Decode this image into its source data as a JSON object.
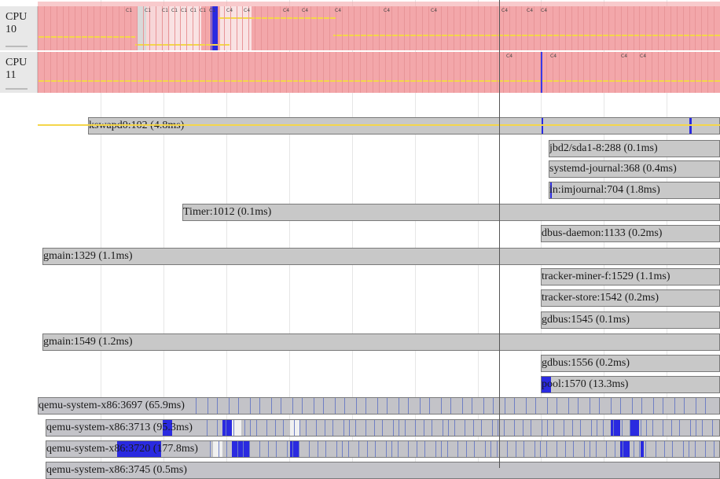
{
  "cpus": [
    {
      "label": "CPU 10",
      "marks": [
        "C1",
        "C1",
        "C1",
        "C1",
        "C1",
        "C1",
        "C1",
        "C1",
        "C4",
        "C4",
        "C4",
        "C4",
        "C4",
        "C4",
        "C4",
        "C4",
        "C4",
        "C4"
      ]
    },
    {
      "label": "CPU 11",
      "marks": [
        "C4",
        "C4",
        "C4",
        "C4"
      ]
    }
  ],
  "threads": [
    {
      "name": "kswapd0",
      "tid": 102,
      "duration": "4.8ms",
      "label": "kswapd0:102 (4.8ms)"
    },
    {
      "name": "jbd2/sda1-8",
      "tid": 288,
      "duration": "0.1ms",
      "label": "jbd2/sda1-8:288 (0.1ms)"
    },
    {
      "name": "systemd-journal",
      "tid": 368,
      "duration": "0.4ms",
      "label": "systemd-journal:368 (0.4ms)"
    },
    {
      "name": "in:imjournal",
      "tid": 704,
      "duration": "1.8ms",
      "label": "in:imjournal:704 (1.8ms)"
    },
    {
      "name": "Timer",
      "tid": 1012,
      "duration": "0.1ms",
      "label": "Timer:1012 (0.1ms)"
    },
    {
      "name": "dbus-daemon",
      "tid": 1133,
      "duration": "0.2ms",
      "label": "dbus-daemon:1133 (0.2ms)"
    },
    {
      "name": "gmain",
      "tid": 1329,
      "duration": "1.1ms",
      "label": "gmain:1329 (1.1ms)"
    },
    {
      "name": "tracker-miner-f",
      "tid": 1529,
      "duration": "1.1ms",
      "label": "tracker-miner-f:1529 (1.1ms)"
    },
    {
      "name": "tracker-store",
      "tid": 1542,
      "duration": "0.2ms",
      "label": "tracker-store:1542 (0.2ms)"
    },
    {
      "name": "gdbus",
      "tid": 1545,
      "duration": "0.1ms",
      "label": "gdbus:1545 (0.1ms)"
    },
    {
      "name": "gmain",
      "tid": 1549,
      "duration": "1.2ms",
      "label": "gmain:1549 (1.2ms)"
    },
    {
      "name": "gdbus",
      "tid": 1556,
      "duration": "0.2ms",
      "label": "gdbus:1556 (0.2ms)"
    },
    {
      "name": "pool",
      "tid": 1570,
      "duration": "13.3ms",
      "label": "pool:1570 (13.3ms)"
    },
    {
      "name": "qemu-system-x86",
      "tid": 3697,
      "duration": "65.9ms",
      "label": "qemu-system-x86:3697 (65.9ms)"
    },
    {
      "name": "qemu-system-x86",
      "tid": 3713,
      "duration": "95.3ms",
      "label": "qemu-system-x86:3713 (95.3ms)"
    },
    {
      "name": "qemu-system-x86",
      "tid": 3720,
      "duration": "177.8ms",
      "label": "qemu-system-x86:3720 (177.8ms)"
    },
    {
      "name": "qemu-system-x86",
      "tid": 3745,
      "duration": "0.5ms",
      "label": "qemu-system-x86:3745 (0.5ms)"
    }
  ],
  "colors": {
    "cpu_busy": "#f3a7aa",
    "freq_line": "#f4d64a",
    "thread_bar": "#c8c8c8",
    "running": "#2a2ae0",
    "grid": "#e6e6e6"
  }
}
